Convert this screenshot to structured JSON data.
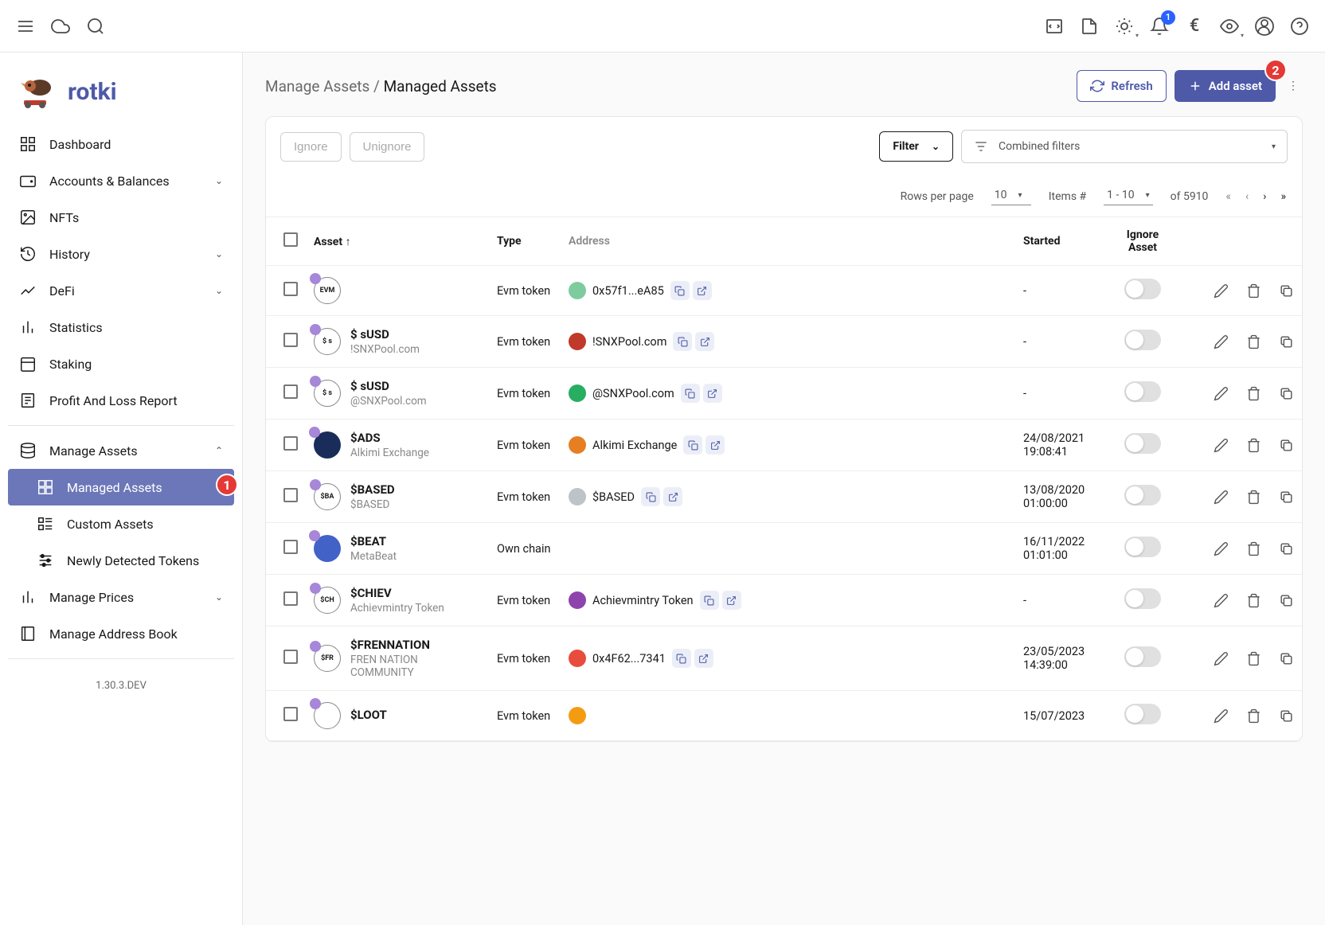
{
  "brand": {
    "name": "rotki"
  },
  "topbar": {
    "notification_count": "1",
    "currency": "€"
  },
  "sidebar": {
    "items": [
      {
        "label": "Dashboard",
        "icon": "dashboard"
      },
      {
        "label": "Accounts & Balances",
        "icon": "wallet",
        "chev": true
      },
      {
        "label": "NFTs",
        "icon": "image"
      },
      {
        "label": "History",
        "icon": "history",
        "chev": true
      },
      {
        "label": "DeFi",
        "icon": "chart",
        "chev": true
      },
      {
        "label": "Statistics",
        "icon": "stats"
      },
      {
        "label": "Staking",
        "icon": "calendar"
      },
      {
        "label": "Profit And Loss Report",
        "icon": "report"
      }
    ],
    "manage_assets": {
      "label": "Manage Assets"
    },
    "sub": [
      {
        "label": "Managed Assets"
      },
      {
        "label": "Custom Assets"
      },
      {
        "label": "Newly Detected Tokens"
      }
    ],
    "manage_prices": {
      "label": "Manage Prices"
    },
    "address_book": {
      "label": "Manage Address Book"
    },
    "version": "1.30.3.DEV"
  },
  "breadcrumb": {
    "parent": "Manage Assets",
    "sep": " / ",
    "current": "Managed Assets"
  },
  "actions": {
    "refresh": "Refresh",
    "add": "Add asset"
  },
  "annotations": {
    "sidebar": "1",
    "add": "2"
  },
  "toolbar": {
    "ignore": "Ignore",
    "unignore": "Unignore",
    "filter": "Filter",
    "combined": "Combined filters"
  },
  "pagination": {
    "rows_label": "Rows per page",
    "rows_value": "10",
    "items_label": "Items #",
    "items_range": "1 - 10",
    "of_label": "of 5910"
  },
  "columns": {
    "asset": "Asset",
    "type": "Type",
    "address": "Address",
    "started": "Started",
    "ignore": "Ignore Asset"
  },
  "rows": [
    {
      "symbol": "",
      "name": "",
      "icon_text": "EVM",
      "icon_bg": "",
      "type": "Evm token",
      "address": "0x57f1...eA85",
      "avatar": "#7ecba0",
      "started": "-",
      "addr_actions": true
    },
    {
      "symbol": "$ sUSD",
      "name": "!SNXPool.com",
      "icon_text": "$ s",
      "icon_bg": "",
      "type": "Evm token",
      "address": "!SNXPool.com",
      "avatar": "#c0392b",
      "started": "-",
      "addr_actions": true
    },
    {
      "symbol": "$ sUSD",
      "name": "@SNXPool.com",
      "icon_text": "$ s",
      "icon_bg": "",
      "type": "Evm token",
      "address": "@SNXPool.com",
      "avatar": "#27ae60",
      "started": "-",
      "addr_actions": true
    },
    {
      "symbol": "$ADS",
      "name": "Alkimi Exchange",
      "icon_text": "",
      "icon_bg": "#1a2d5a",
      "type": "Evm token",
      "address": "Alkimi Exchange",
      "avatar": "#e67e22",
      "started": "24/08/2021 19:08:41",
      "addr_actions": true
    },
    {
      "symbol": "$BASED",
      "name": "$BASED",
      "icon_text": "$BA",
      "icon_bg": "",
      "type": "Evm token",
      "address": "$BASED",
      "avatar": "#bdc3c7",
      "started": "13/08/2020 01:00:00",
      "addr_actions": true
    },
    {
      "symbol": "$BEAT",
      "name": "MetaBeat",
      "icon_text": "",
      "icon_bg": "#4262c7",
      "type": "Own chain",
      "address": "",
      "avatar": "",
      "started": "16/11/2022 01:01:00",
      "addr_actions": false
    },
    {
      "symbol": "$CHIEV",
      "name": "Achievmintry Token",
      "icon_text": "$CH",
      "icon_bg": "",
      "type": "Evm token",
      "address": "Achievmintry Token",
      "avatar": "#8e44ad",
      "started": "-",
      "addr_actions": true
    },
    {
      "symbol": "$FRENNATION",
      "name": "FREN NATION COMMUNITY",
      "icon_text": "$FR",
      "icon_bg": "",
      "type": "Evm token",
      "address": "0x4F62...7341",
      "avatar": "#e74c3c",
      "started": "23/05/2023 14:39:00",
      "addr_actions": true
    },
    {
      "symbol": "$LOOT",
      "name": "",
      "icon_text": "",
      "icon_bg": "",
      "type": "Evm token",
      "address": "",
      "avatar": "#f39c12",
      "started": "15/07/2023",
      "addr_actions": false
    }
  ]
}
